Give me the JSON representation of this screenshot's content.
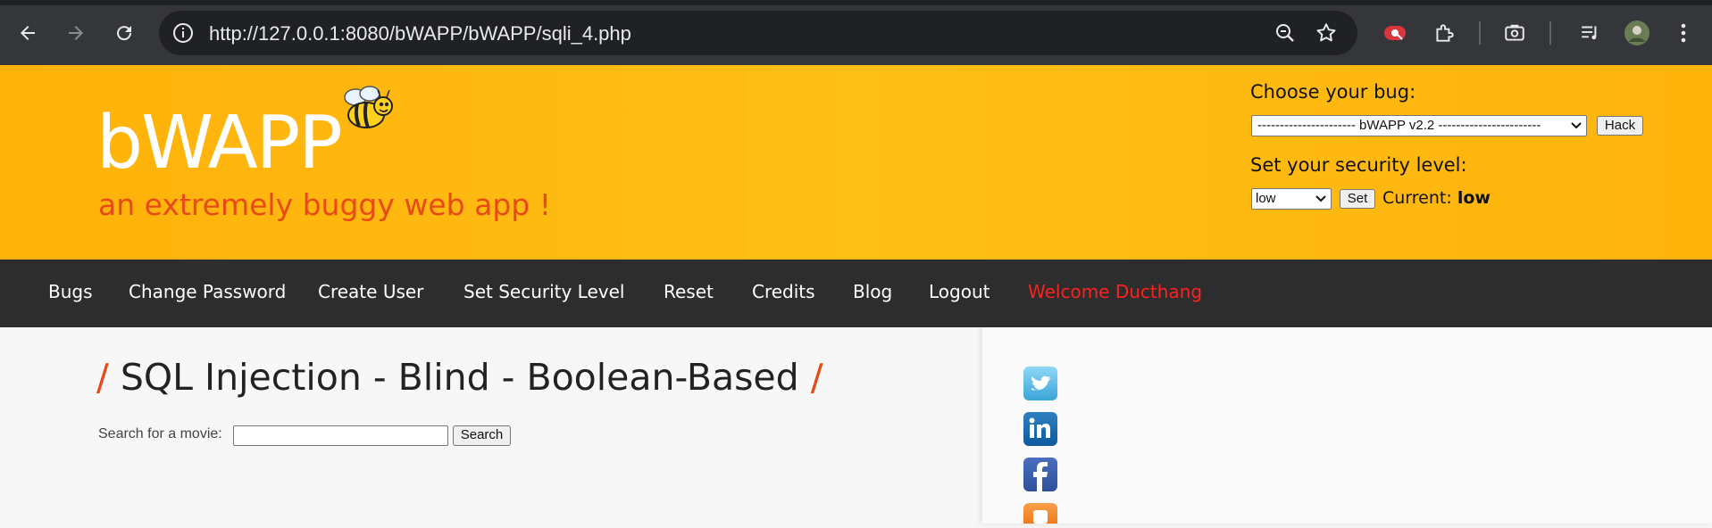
{
  "browser": {
    "url": "http://127.0.0.1:8080/bWAPP/bWAPP/sqli_4.php",
    "icons": [
      "back-icon",
      "forward-icon",
      "reload-icon",
      "site-info-icon",
      "zoom-icon",
      "bookmark-star-icon",
      "extension-record-icon",
      "extensions-puzzle-icon",
      "screenshot-icon",
      "media-queue-icon",
      "profile-avatar",
      "more-menu-icon"
    ]
  },
  "header": {
    "logo": "bWAPP",
    "tagline": "an extremely buggy web app !",
    "choose_bug_label": "Choose your bug:",
    "bug_select_value": "---------------------- bWAPP v2.2 -----------------------",
    "hack_button": "Hack",
    "security_label": "Set your security level:",
    "security_select_value": "low",
    "set_button": "Set",
    "current_label": "Current:",
    "current_value": "low"
  },
  "menu": {
    "items": [
      "Bugs",
      "Change Password",
      "Create User",
      "Set Security Level",
      "Reset",
      "Credits",
      "Blog",
      "Logout"
    ],
    "welcome": "Welcome Ducthang"
  },
  "main": {
    "title_slash_left": "/",
    "title": "SQL Injection - Blind - Boolean-Based",
    "title_slash_right": "/",
    "search_label": "Search for a movie:",
    "search_value": "",
    "search_button": "Search"
  },
  "social": [
    "twitter-icon",
    "linkedin-icon",
    "facebook-icon",
    "blogger-icon"
  ],
  "colors": {
    "header_bg": "#ffb80f",
    "accent_orange": "#e84a16",
    "menu_bg": "#2d2d2d",
    "welcome_red": "#ff2020",
    "chrome_bg": "#35363a"
  }
}
